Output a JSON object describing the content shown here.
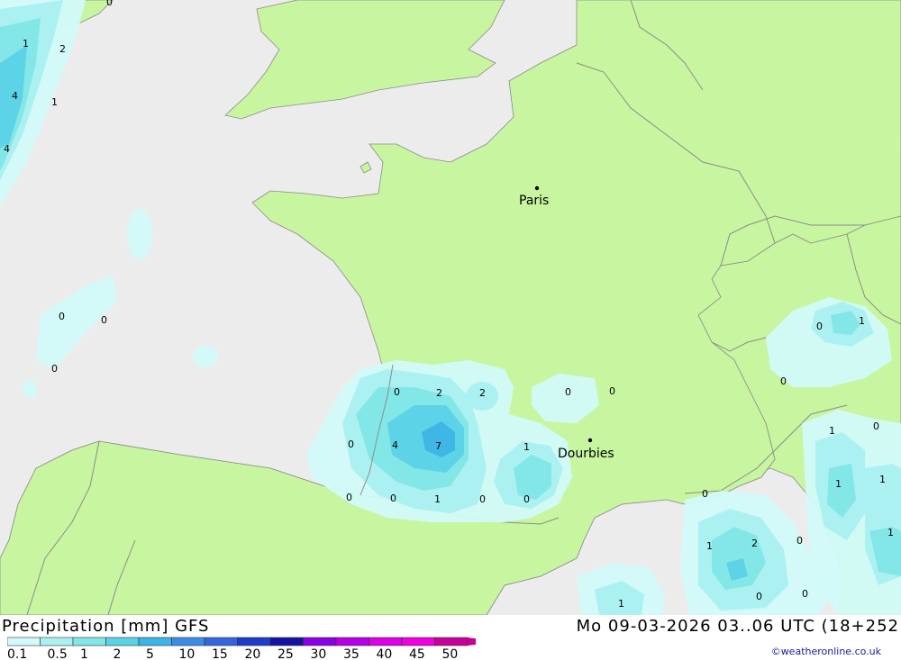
{
  "header": {
    "title": "Precipitation [mm] GFS",
    "datetime": "Mo 09-03-2026 03..06 UTC (18+252",
    "credit": "©weatheronline.co.uk"
  },
  "legend": {
    "values": [
      "0.1",
      "0.5",
      "1",
      "2",
      "5",
      "10",
      "15",
      "20",
      "25",
      "30",
      "35",
      "40",
      "45",
      "50"
    ],
    "colors": [
      "#d2fafa",
      "#aaf0f0",
      "#82e6e6",
      "#5ad2e6",
      "#3cb4e6",
      "#3c8ce6",
      "#3264dc",
      "#1e3cc8",
      "#1414a0",
      "#8c00e6",
      "#b400e6",
      "#dc00e6",
      "#f000dc",
      "#c8009b"
    ]
  },
  "map": {
    "colors": {
      "sea": "#ececec",
      "land": "#c8f5a0",
      "border": "#8c8c8c"
    },
    "cities": [
      {
        "name": "Paris"
      },
      {
        "name": "Dourbies"
      }
    ],
    "labels": [
      "1",
      "2",
      "4",
      "1",
      "4",
      "0",
      "0",
      "0",
      "0",
      "0",
      "2",
      "2",
      "0",
      "0",
      "0",
      "4",
      "7",
      "1",
      "0",
      "0",
      "1",
      "0",
      "0",
      "0",
      "1",
      "0",
      "1",
      "0",
      "1",
      "1",
      "1",
      "2",
      "0",
      "1",
      "0",
      "0",
      "0",
      "1"
    ]
  }
}
